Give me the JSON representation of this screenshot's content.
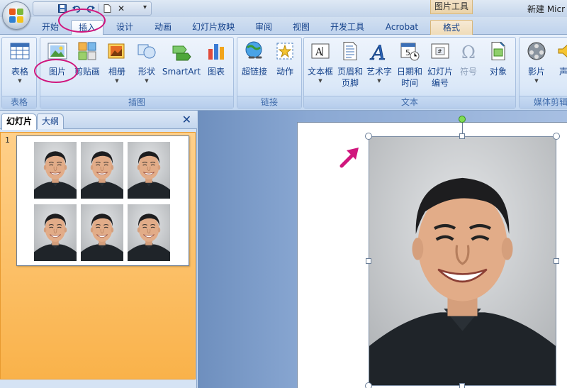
{
  "window": {
    "title": "新建 Micr",
    "context_tab_group": "图片工具"
  },
  "tabs": [
    {
      "label": "开始",
      "active": false
    },
    {
      "label": "插入",
      "active": true
    },
    {
      "label": "设计",
      "active": false
    },
    {
      "label": "动画",
      "active": false
    },
    {
      "label": "幻灯片放映",
      "active": false
    },
    {
      "label": "审阅",
      "active": false
    },
    {
      "label": "视图",
      "active": false
    },
    {
      "label": "开发工具",
      "active": false
    },
    {
      "label": "Acrobat",
      "active": false
    },
    {
      "label": "格式",
      "active": false
    }
  ],
  "ribbon": {
    "groups": [
      {
        "label": "表格",
        "buttons": [
          {
            "label": "表格",
            "icon": "table-icon",
            "has_arrow": true
          }
        ]
      },
      {
        "label": "插图",
        "buttons": [
          {
            "label": "图片",
            "icon": "picture-icon",
            "has_arrow": false
          },
          {
            "label": "剪贴画",
            "icon": "clipart-icon",
            "has_arrow": false
          },
          {
            "label": "相册",
            "icon": "photo-album-icon",
            "has_arrow": true
          },
          {
            "label": "形状",
            "icon": "shapes-icon",
            "has_arrow": true
          },
          {
            "label": "SmartArt",
            "icon": "smartart-icon",
            "has_arrow": false
          },
          {
            "label": "图表",
            "icon": "chart-icon",
            "has_arrow": false
          }
        ]
      },
      {
        "label": "链接",
        "buttons": [
          {
            "label": "超链接",
            "icon": "hyperlink-icon",
            "has_arrow": false
          },
          {
            "label": "动作",
            "icon": "action-icon",
            "has_arrow": false
          }
        ]
      },
      {
        "label": "文本",
        "buttons": [
          {
            "label": "文本框",
            "icon": "textbox-icon",
            "has_arrow": true
          },
          {
            "label": "页眉和",
            "label2": "页脚",
            "icon": "header-footer-icon",
            "has_arrow": false
          },
          {
            "label": "艺术字",
            "icon": "wordart-icon",
            "has_arrow": true
          },
          {
            "label": "日期和",
            "label2": "时间",
            "icon": "date-time-icon",
            "has_arrow": false
          },
          {
            "label": "幻灯片",
            "label2": "编号",
            "icon": "slide-number-icon",
            "has_arrow": false
          },
          {
            "label": "符号",
            "icon": "symbol-icon",
            "has_arrow": false,
            "disabled": true
          },
          {
            "label": "对象",
            "icon": "object-icon",
            "has_arrow": false
          }
        ]
      },
      {
        "label": "媒体剪辑",
        "buttons": [
          {
            "label": "影片",
            "icon": "movie-icon",
            "has_arrow": true
          },
          {
            "label": "声",
            "icon": "sound-icon",
            "has_arrow": false
          }
        ]
      }
    ]
  },
  "left_panel": {
    "tabs": [
      "幻灯片",
      "大纲"
    ],
    "active_tab": "幻灯片",
    "slide_number": "1"
  },
  "colors": {
    "annotation": "#d0167d",
    "ribbon_text": "#15428b",
    "thumb_selected": "#f9b24a"
  }
}
